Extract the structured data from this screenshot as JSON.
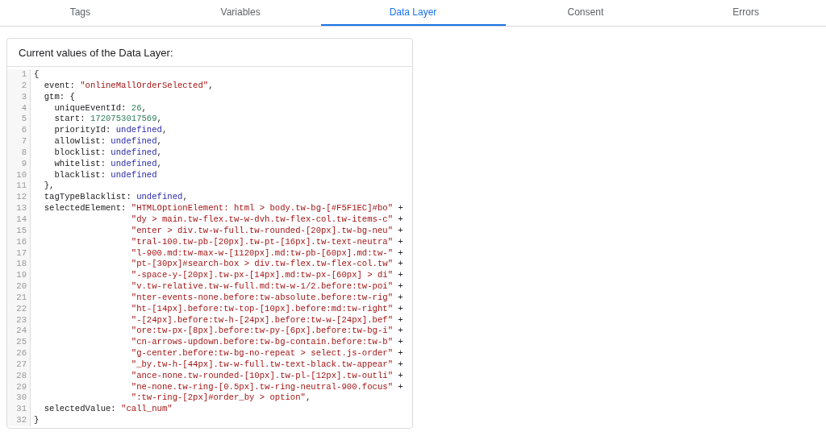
{
  "tabs": [
    {
      "label": "Tags",
      "selected": false
    },
    {
      "label": "Variables",
      "selected": false
    },
    {
      "label": "Data Layer",
      "selected": true
    },
    {
      "label": "Consent",
      "selected": false
    },
    {
      "label": "Errors",
      "selected": false
    }
  ],
  "panel": {
    "title": "Current values of the Data Layer:",
    "code_lines": [
      {
        "number": "1",
        "tokens": [
          {
            "kind": "plain",
            "text": "{"
          }
        ]
      },
      {
        "number": "2",
        "tokens": [
          {
            "kind": "plain",
            "text": "  event: "
          },
          {
            "kind": "string",
            "text": "\"onlineMallOrderSelected\""
          },
          {
            "kind": "plain",
            "text": ","
          }
        ]
      },
      {
        "number": "3",
        "tokens": [
          {
            "kind": "plain",
            "text": "  gtm: {"
          }
        ]
      },
      {
        "number": "4",
        "tokens": [
          {
            "kind": "plain",
            "text": "    uniqueEventId: "
          },
          {
            "kind": "number",
            "text": "26"
          },
          {
            "kind": "plain",
            "text": ","
          }
        ]
      },
      {
        "number": "5",
        "tokens": [
          {
            "kind": "plain",
            "text": "    start: "
          },
          {
            "kind": "number",
            "text": "1720753017569"
          },
          {
            "kind": "plain",
            "text": ","
          }
        ]
      },
      {
        "number": "6",
        "tokens": [
          {
            "kind": "plain",
            "text": "    priorityId: "
          },
          {
            "kind": "keyword",
            "text": "undefined"
          },
          {
            "kind": "plain",
            "text": ","
          }
        ]
      },
      {
        "number": "7",
        "tokens": [
          {
            "kind": "plain",
            "text": "    allowlist: "
          },
          {
            "kind": "keyword",
            "text": "undefined"
          },
          {
            "kind": "plain",
            "text": ","
          }
        ]
      },
      {
        "number": "8",
        "tokens": [
          {
            "kind": "plain",
            "text": "    blocklist: "
          },
          {
            "kind": "keyword",
            "text": "undefined"
          },
          {
            "kind": "plain",
            "text": ","
          }
        ]
      },
      {
        "number": "9",
        "tokens": [
          {
            "kind": "plain",
            "text": "    whitelist: "
          },
          {
            "kind": "keyword",
            "text": "undefined"
          },
          {
            "kind": "plain",
            "text": ","
          }
        ]
      },
      {
        "number": "10",
        "tokens": [
          {
            "kind": "plain",
            "text": "    blacklist: "
          },
          {
            "kind": "keyword",
            "text": "undefined"
          }
        ]
      },
      {
        "number": "11",
        "tokens": [
          {
            "kind": "plain",
            "text": "  },"
          }
        ]
      },
      {
        "number": "12",
        "tokens": [
          {
            "kind": "plain",
            "text": "  tagTypeBlacklist: "
          },
          {
            "kind": "keyword",
            "text": "undefined"
          },
          {
            "kind": "plain",
            "text": ","
          }
        ]
      },
      {
        "number": "13",
        "tokens": [
          {
            "kind": "plain",
            "text": "  selectedElement: "
          },
          {
            "kind": "string",
            "text": "\"HTMLOptionElement: html > body.tw-bg-[#F5F1EC]#bo\""
          },
          {
            "kind": "plain",
            "text": " +"
          }
        ]
      },
      {
        "number": "14",
        "continuation": true,
        "tokens": [
          {
            "kind": "string",
            "text": "\"dy > main.tw-flex.tw-w-dvh.tw-flex-col.tw-items-c\""
          },
          {
            "kind": "plain",
            "text": " +"
          }
        ]
      },
      {
        "number": "15",
        "continuation": true,
        "tokens": [
          {
            "kind": "string",
            "text": "\"enter > div.tw-w-full.tw-rounded-[20px].tw-bg-neu\""
          },
          {
            "kind": "plain",
            "text": " +"
          }
        ]
      },
      {
        "number": "16",
        "continuation": true,
        "tokens": [
          {
            "kind": "string",
            "text": "\"tral-100.tw-pb-[20px].tw-pt-[16px].tw-text-neutra\""
          },
          {
            "kind": "plain",
            "text": " +"
          }
        ]
      },
      {
        "number": "17",
        "continuation": true,
        "tokens": [
          {
            "kind": "string",
            "text": "\"l-900.md:tw-max-w-[1120px].md:tw-pb-[60px].md:tw-\""
          },
          {
            "kind": "plain",
            "text": " +"
          }
        ]
      },
      {
        "number": "18",
        "continuation": true,
        "tokens": [
          {
            "kind": "string",
            "text": "\"pt-[30px]#search-box > div.tw-flex.tw-flex-col.tw\""
          },
          {
            "kind": "plain",
            "text": " +"
          }
        ]
      },
      {
        "number": "19",
        "continuation": true,
        "tokens": [
          {
            "kind": "string",
            "text": "\"-space-y-[20px].tw-px-[14px].md:tw-px-[60px] > di\""
          },
          {
            "kind": "plain",
            "text": " +"
          }
        ]
      },
      {
        "number": "20",
        "continuation": true,
        "tokens": [
          {
            "kind": "string",
            "text": "\"v.tw-relative.tw-w-full.md:tw-w-1/2.before:tw-poi\""
          },
          {
            "kind": "plain",
            "text": " +"
          }
        ]
      },
      {
        "number": "21",
        "continuation": true,
        "tokens": [
          {
            "kind": "string",
            "text": "\"nter-events-none.before:tw-absolute.before:tw-rig\""
          },
          {
            "kind": "plain",
            "text": " +"
          }
        ]
      },
      {
        "number": "22",
        "continuation": true,
        "tokens": [
          {
            "kind": "string",
            "text": "\"ht-[14px].before:tw-top-[10px].before:md:tw-right\""
          },
          {
            "kind": "plain",
            "text": " +"
          }
        ]
      },
      {
        "number": "23",
        "continuation": true,
        "tokens": [
          {
            "kind": "string",
            "text": "\"-[24px].before:tw-h-[24px].before:tw-w-[24px].bef\""
          },
          {
            "kind": "plain",
            "text": " +"
          }
        ]
      },
      {
        "number": "24",
        "continuation": true,
        "tokens": [
          {
            "kind": "string",
            "text": "\"ore:tw-px-[8px].before:tw-py-[6px].before:tw-bg-i\""
          },
          {
            "kind": "plain",
            "text": " +"
          }
        ]
      },
      {
        "number": "25",
        "continuation": true,
        "tokens": [
          {
            "kind": "string",
            "text": "\"cn-arrows-updown.before:tw-bg-contain.before:tw-b\""
          },
          {
            "kind": "plain",
            "text": " +"
          }
        ]
      },
      {
        "number": "26",
        "continuation": true,
        "tokens": [
          {
            "kind": "string",
            "text": "\"g-center.before:tw-bg-no-repeat > select.js-order\""
          },
          {
            "kind": "plain",
            "text": " +"
          }
        ]
      },
      {
        "number": "27",
        "continuation": true,
        "tokens": [
          {
            "kind": "string",
            "text": "\"_by.tw-h-[44px].tw-w-full.tw-text-black.tw-appear\""
          },
          {
            "kind": "plain",
            "text": " +"
          }
        ]
      },
      {
        "number": "28",
        "continuation": true,
        "tokens": [
          {
            "kind": "string",
            "text": "\"ance-none.tw-rounded-[10px].tw-pl-[12px].tw-outli\""
          },
          {
            "kind": "plain",
            "text": " +"
          }
        ]
      },
      {
        "number": "29",
        "continuation": true,
        "tokens": [
          {
            "kind": "string",
            "text": "\"ne-none.tw-ring-[0.5px].tw-ring-neutral-900.focus\""
          },
          {
            "kind": "plain",
            "text": " +"
          }
        ]
      },
      {
        "number": "30",
        "continuation": true,
        "tokens": [
          {
            "kind": "string",
            "text": "\":tw-ring-[2px]#order_by > option\""
          },
          {
            "kind": "plain",
            "text": ","
          }
        ]
      },
      {
        "number": "31",
        "tokens": [
          {
            "kind": "plain",
            "text": "  selectedValue: "
          },
          {
            "kind": "string",
            "text": "\"call_num\""
          }
        ]
      },
      {
        "number": "32",
        "tokens": [
          {
            "kind": "plain",
            "text": "}"
          }
        ]
      }
    ]
  }
}
